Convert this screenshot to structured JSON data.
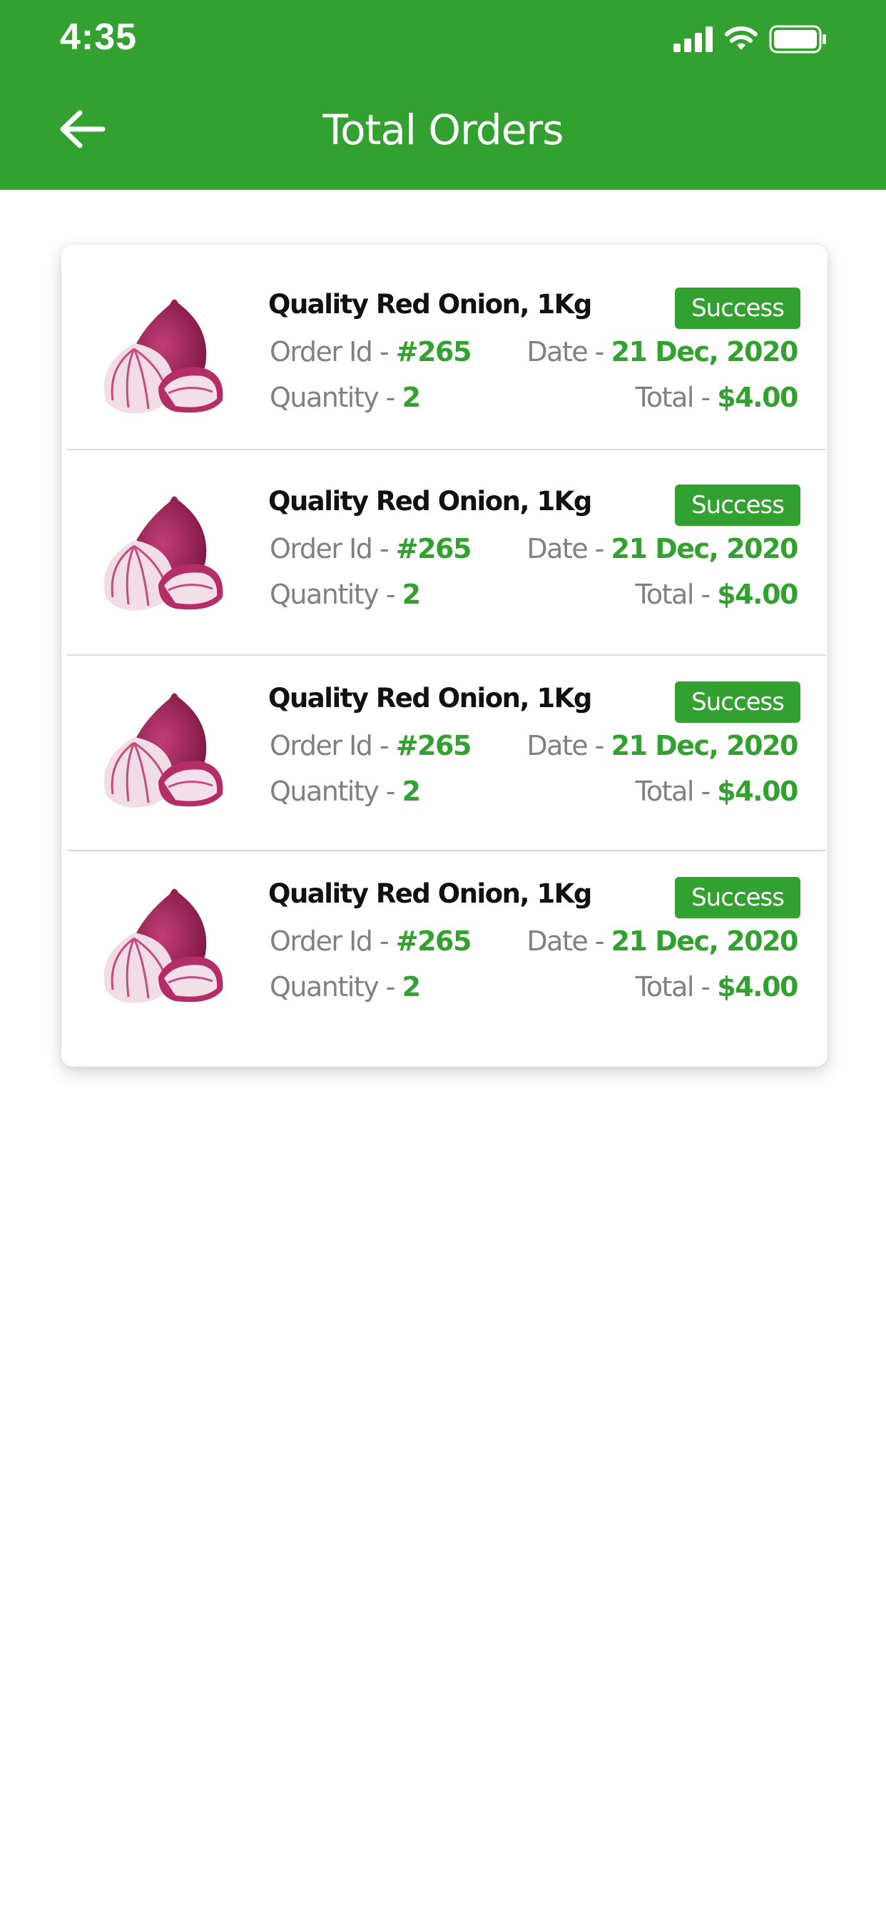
{
  "status_bar": {
    "time": "4:35"
  },
  "header": {
    "title": "Total Orders"
  },
  "orders": [
    {
      "name": "Quality Red Onion, 1Kg",
      "order_id_label": "Order Id - ",
      "order_id": "#265",
      "quantity_label": "Quantity - ",
      "quantity": "2",
      "date_label": "Date - ",
      "date": "21 Dec, 2020",
      "total_label": "Total - ",
      "total": "$4.00",
      "status": "Success"
    },
    {
      "name": "Quality Red Onion, 1Kg",
      "order_id_label": "Order Id - ",
      "order_id": "#265",
      "quantity_label": "Quantity - ",
      "quantity": "2",
      "date_label": "Date - ",
      "date": "21 Dec, 2020",
      "total_label": "Total - ",
      "total": "$4.00",
      "status": "Success"
    },
    {
      "name": "Quality Red Onion, 1Kg",
      "order_id_label": "Order Id - ",
      "order_id": "#265",
      "quantity_label": "Quantity - ",
      "quantity": "2",
      "date_label": "Date - ",
      "date": "21 Dec, 2020",
      "total_label": "Total - ",
      "total": "$4.00",
      "status": "Success"
    },
    {
      "name": "Quality Red Onion, 1Kg",
      "order_id_label": "Order Id - ",
      "order_id": "#265",
      "quantity_label": "Quantity - ",
      "quantity": "2",
      "date_label": "Date - ",
      "date": "21 Dec, 2020",
      "total_label": "Total - ",
      "total": "$4.00",
      "status": "Success"
    }
  ],
  "colors": {
    "brand": "#33a12f",
    "onion": "#a3235a",
    "muted_text": "#808080"
  },
  "icons": {
    "back": "arrow-left-icon",
    "signal": "cellular-signal-icon",
    "wifi": "wifi-icon",
    "battery": "battery-icon",
    "product": "red-onion-image"
  }
}
